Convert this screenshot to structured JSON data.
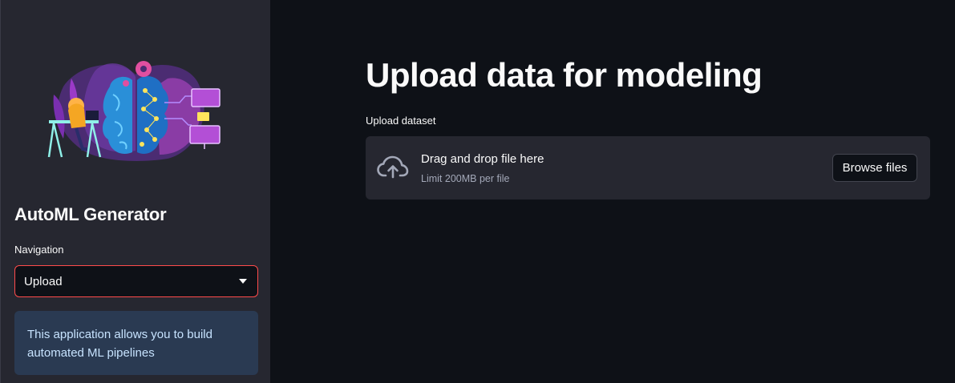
{
  "sidebar": {
    "title": "AutoML Generator",
    "nav_label": "Navigation",
    "nav_selected": "Upload",
    "info_text": "This application allows you to build automated ML pipelines"
  },
  "main": {
    "title": "Upload data for modeling",
    "upload_label": "Upload dataset",
    "dropzone": {
      "primary_text": "Drag and drop file here",
      "limit_text": "Limit 200MB per file",
      "browse_label": "Browse files",
      "icon": "cloud-upload-icon"
    }
  },
  "colors": {
    "background": "#0e1117",
    "sidebar": "#262730",
    "accent": "#ff4b4b",
    "info_bg": "#2a3a52",
    "info_text": "#c7e3ff"
  }
}
